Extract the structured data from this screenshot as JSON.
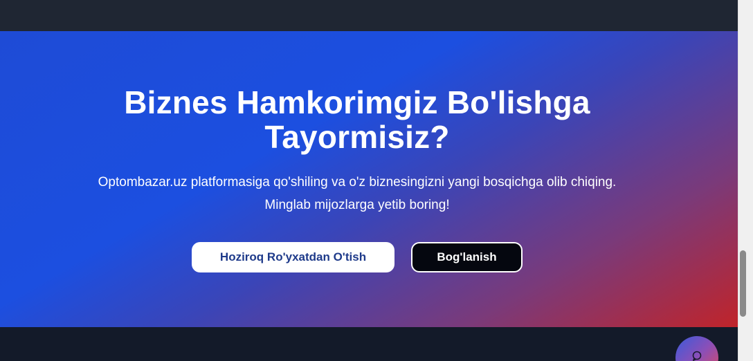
{
  "hero": {
    "title": "Biznes Hamkorimgiz Bo'lishga Tayormisiz?",
    "text": "Optombazar.uz platformasiga qo'shiling va o'z biznesingizni yangi bosqichga olib chiqing. Minglab mijozlarga yetib boring!",
    "primary_button": "Hoziroq Ro'yxatdan O'tish",
    "secondary_button": "Bog'lanish"
  },
  "chat_widget": {
    "icon": "chat-bubble-icon"
  },
  "colors": {
    "hero_gradient_start": "#1e4bd6",
    "hero_gradient_end": "#c0242a",
    "primary_button_text": "#1e3a8a",
    "secondary_button_bg": "#05070f"
  }
}
